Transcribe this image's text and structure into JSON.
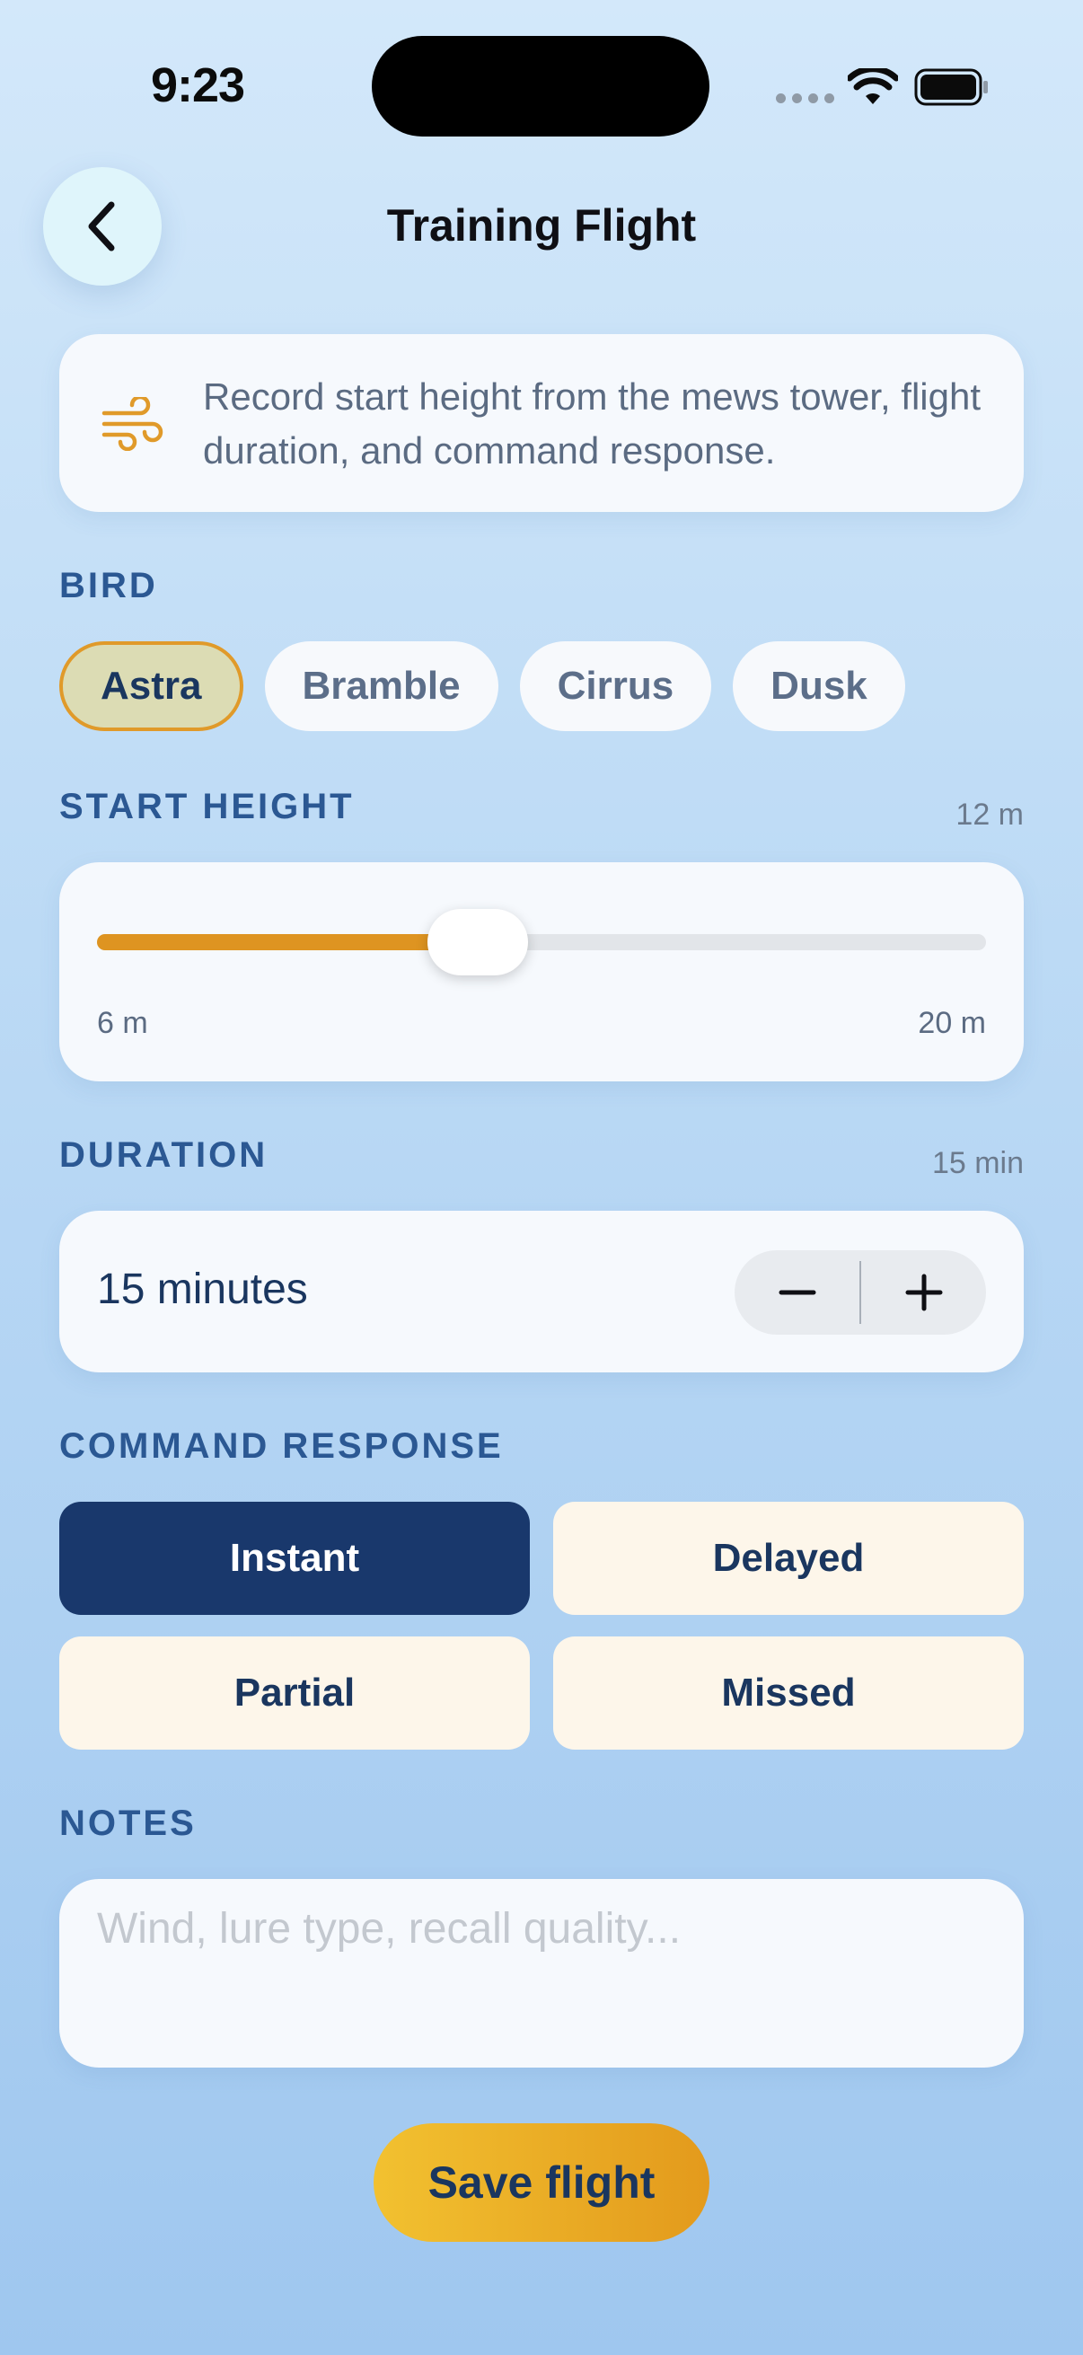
{
  "status_bar": {
    "time": "9:23"
  },
  "header": {
    "title": "Training Flight",
    "back_icon": "chevron-left-icon"
  },
  "info": {
    "icon": "wind-icon",
    "text": "Record start height from the mews tower, flight duration, and command response."
  },
  "bird": {
    "label": "BIRD",
    "options": [
      "Astra",
      "Bramble",
      "Cirrus",
      "Dusk"
    ],
    "selected": "Astra"
  },
  "start_height": {
    "label": "START HEIGHT",
    "value_text": "12 m",
    "min_label": "6 m",
    "max_label": "20 m",
    "min": 6,
    "max": 20,
    "value": 12
  },
  "duration": {
    "label": "DURATION",
    "value_text": "15 min",
    "field_value": "15 minutes",
    "decrement": "−",
    "increment": "+"
  },
  "command_response": {
    "label": "COMMAND RESPONSE",
    "options": [
      "Instant",
      "Delayed",
      "Partial",
      "Missed"
    ],
    "selected": "Instant"
  },
  "notes": {
    "label": "NOTES",
    "placeholder": "Wind, lure type, recall quality..."
  },
  "save_button": "Save flight",
  "colors": {
    "accent": "#de9421",
    "primary": "#19386c",
    "label": "#2b5893"
  }
}
